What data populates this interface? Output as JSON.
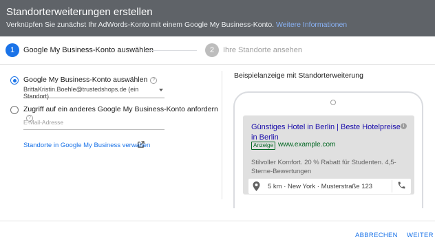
{
  "header": {
    "title": "Standorterweiterungen erstellen",
    "subtitle": "Verknüpfen Sie zunächst Ihr AdWords-Konto mit einem Google My Business-Konto.",
    "more_info_link": "Weitere Informationen",
    "background": "#5f6368"
  },
  "stepper": {
    "steps": [
      {
        "number": "1",
        "label": "Google My Business-Konto auswählen",
        "active": true
      },
      {
        "number": "2",
        "label": "Ihre Standorte ansehen",
        "active": false
      }
    ],
    "active_color": "#1a73e8",
    "inactive_color": "#bdbdbd"
  },
  "options": {
    "own_account": {
      "label": "Google My Business-Konto auswählen",
      "selected": true,
      "account_value": "BrittaKristin.Boehle@trustedshops.de (ein Standort)"
    },
    "other_account": {
      "label": "Zugriff auf ein anderes Google My Business-Konto anfordern",
      "selected": false,
      "email_placeholder": "E-Mail-Adresse"
    },
    "manage_link": "Standorte in Google My Business verwalten"
  },
  "preview": {
    "title": "Beispielanzeige mit Standorterweiterung",
    "ad": {
      "headline": "Günstiges Hotel in Berlin | Beste Hotelpreise in Berlin",
      "badge": "Anzeige",
      "url": "www.example.com",
      "description": "Stilvoller Komfort. 20 % Rabatt für Studenten. 4,5-Sterne-Bewertungen",
      "location": "5 km · New York · Musterstraße 123"
    }
  },
  "footer": {
    "cancel": "ABBRECHEN",
    "next": "WEITER"
  }
}
